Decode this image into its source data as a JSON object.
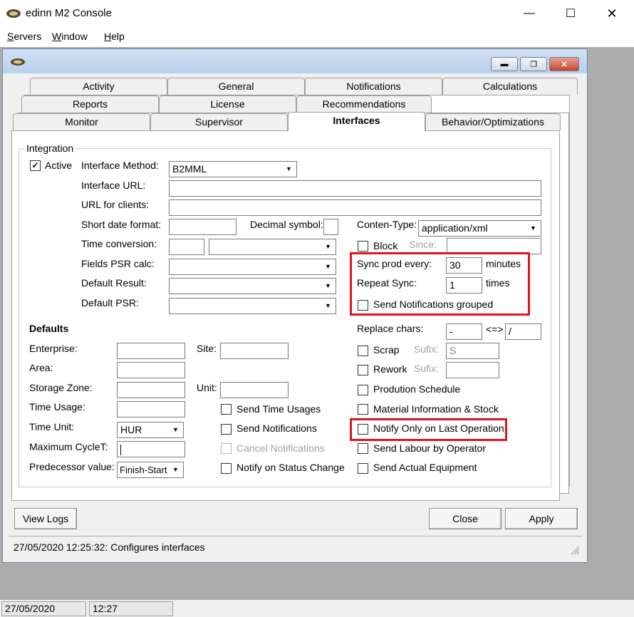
{
  "app": {
    "title": "edinn M2 Console"
  },
  "menu": [
    {
      "accel": "S",
      "rest": "ervers"
    },
    {
      "accel": "W",
      "rest": "indow"
    },
    {
      "accel": "H",
      "rest": "elp"
    }
  ],
  "tabs_row1": [
    "Activity",
    "General",
    "Notifications",
    "Calculations"
  ],
  "tabs_row2": [
    "Reports",
    "License",
    "Recommendations"
  ],
  "tabs_row3": [
    "Monitor",
    "Supervisor",
    "Interfaces",
    "Behavior/Optimizations"
  ],
  "integration": {
    "group_label": "Integration",
    "active_label": "Active",
    "active_checked": "✓",
    "interface_method_label": "Interface Method:",
    "interface_method_value": "B2MML",
    "interface_url_label": "Interface URL:",
    "interface_url_value": "",
    "url_clients_label": "URL for clients:",
    "url_clients_value": "",
    "short_date_label": "Short date format:",
    "short_date_value": "",
    "decimal_label": "Decimal symbol:",
    "decimal_value": "",
    "content_type_label": "Conten-Type:",
    "content_type_value": "application/xml",
    "time_conv_label": "Time conversion:",
    "block_label": "Block",
    "since_label": "Since:",
    "fields_psr_label": "Fields PSR calc:",
    "default_result_label": "Default Result:",
    "default_psr_label": "Default PSR:",
    "sync_label": "Sync prod every:",
    "sync_value": "30",
    "sync_unit": "minutes",
    "repeat_label": "Repeat Sync:",
    "repeat_value": "1",
    "repeat_unit": "times",
    "send_grouped_label": "Send Notifications grouped",
    "replace_label": "Replace chars:",
    "replace_from": "-",
    "replace_arrow": "<=>",
    "replace_to": "/",
    "scrap_label": "Scrap",
    "scrap_sufix_label": "Sufix:",
    "scrap_sufix_value": "S",
    "rework_label": "Rework",
    "rework_sufix_label": "Sufix:",
    "prod_schedule_label": "Prodution Schedule",
    "material_label": "Material Information & Stock",
    "notify_last_label": "Notify Only on Last Operation",
    "send_labour_label": "Send Labour by Operator",
    "send_equipment_label": "Send Actual Equipment"
  },
  "defaults": {
    "title": "Defaults",
    "enterprise_label": "Enterprise:",
    "site_label": "Site:",
    "area_label": "Area:",
    "storage_label": "Storage Zone:",
    "unit_label": "Unit:",
    "time_usage_label": "Time Usage:",
    "time_unit_label": "Time Unit:",
    "time_unit_value": "HUR",
    "max_cycle_label": "Maximum CycleT:",
    "predecessor_label": "Predecessor value:",
    "predecessor_value": "Finish-Start",
    "send_time_usages_label": "Send Time Usages",
    "send_notifications_label": "Send Notifications",
    "cancel_notifications_label": "Cancel Notifications",
    "notify_status_label": "Notify on Status Change"
  },
  "buttons": {
    "view_logs": "View Logs",
    "close": "Close",
    "apply": "Apply"
  },
  "status": {
    "message": "27/05/2020 12:25:32: Configures interfaces",
    "date": "27/05/2020",
    "time": "12:27"
  }
}
